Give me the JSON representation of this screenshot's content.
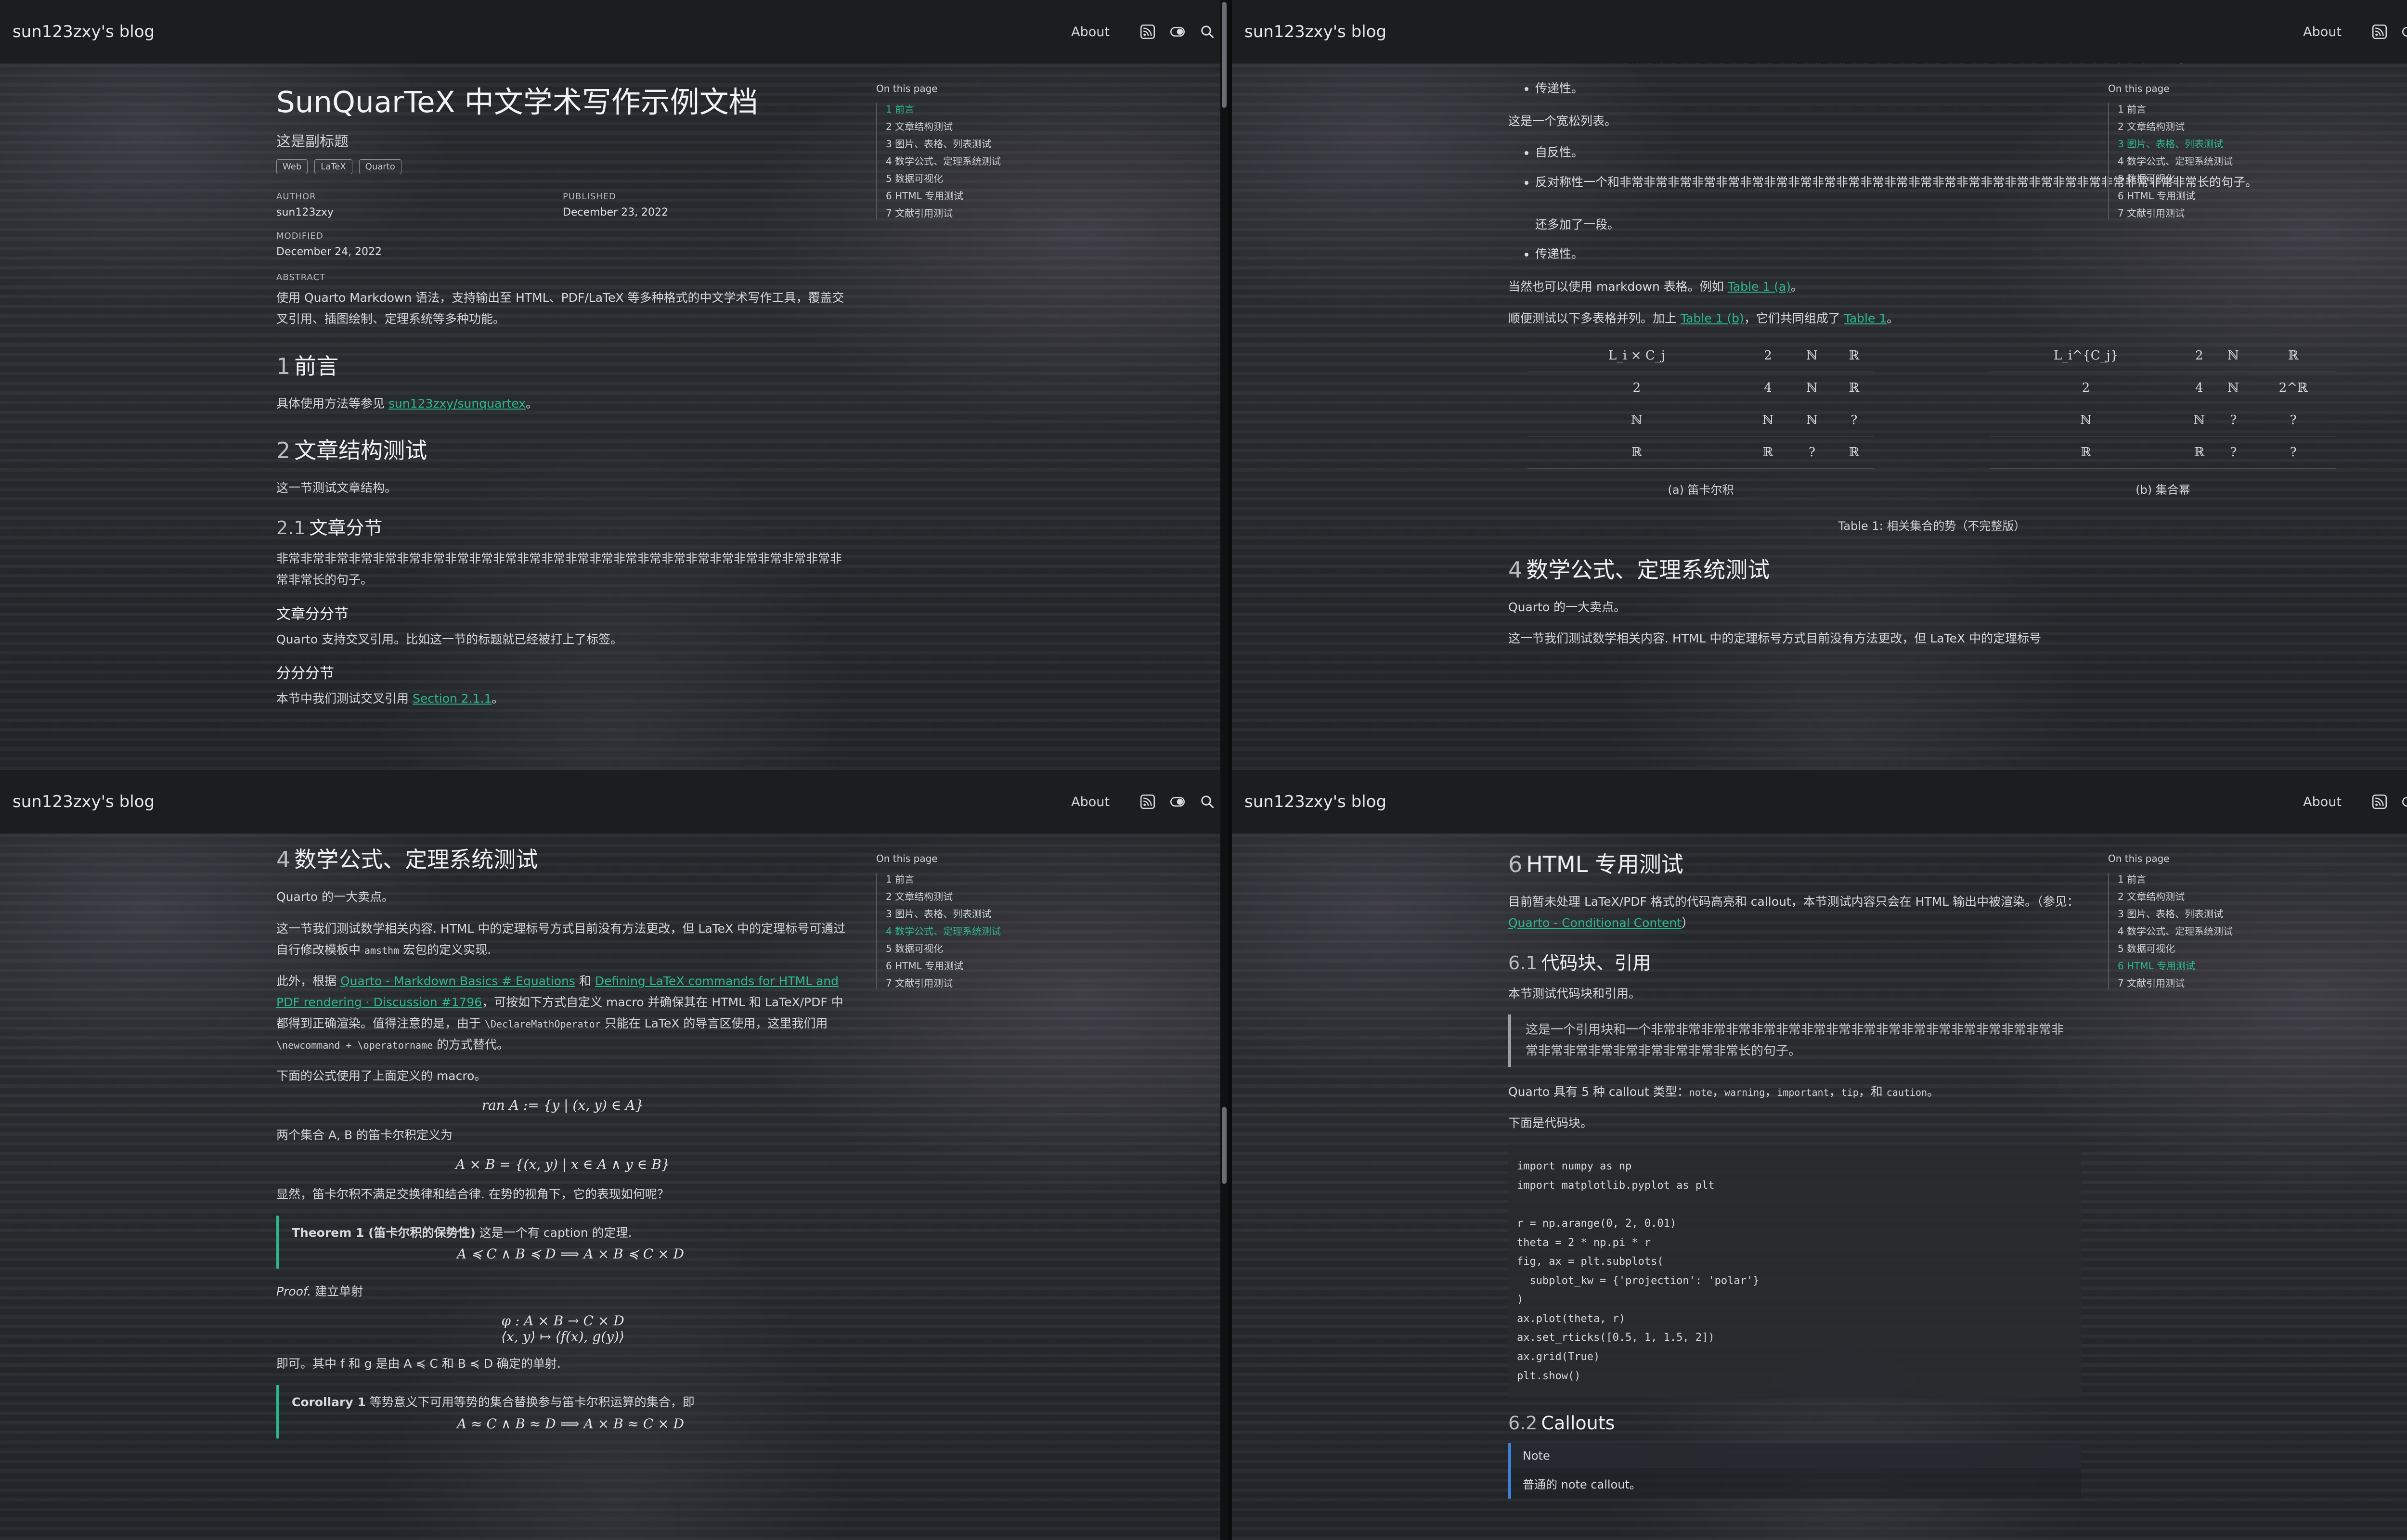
{
  "brand": "sun123zxy's blog",
  "nav": {
    "about": "About"
  },
  "toc": {
    "title": "On this page",
    "items": [
      "1 前言",
      "2 文章结构测试",
      "3 图片、表格、列表测试",
      "4 数学公式、定理系统测试",
      "5 数据可视化",
      "6 HTML 专用测试",
      "7 文献引用测试"
    ]
  },
  "p1": {
    "title": "SunQuarTeX 中文学术写作示例文档",
    "subtitle": "这是副标题",
    "cats": [
      "Web",
      "LaTeX",
      "Quarto"
    ],
    "meta": {
      "author_label": "Author",
      "author": "sun123zxy",
      "published_label": "Published",
      "published": "December 23, 2022",
      "modified_label": "Modified",
      "modified": "December 24, 2022"
    },
    "abstract_label": "Abstract",
    "abstract": "使用 Quarto Markdown 语法，支持输出至 HTML、PDF/LaTeX 等多种格式的中文学术写作工具，覆盖交叉引用、插图绘制、定理系统等多种功能。",
    "h_intro_num": "1",
    "h_intro": "前言",
    "intro_text": "具体使用方法等参见 ",
    "intro_link": "sun123zxy/sunquartex",
    "intro_end": "。",
    "h_struct_num": "2",
    "h_struct": "文章结构测试",
    "struct_text": "这一节测试文章结构。",
    "h_sub_num": "2.1",
    "h_sub": "文章分节",
    "sub_text": "非常非常非常非常非常非常非常非常非常非常非常非常非常非常非常非常非常非常非常非常非常非常非常非常非常长的句子。",
    "h_subsub": "文章分分节",
    "subsub_text": "Quarto 支持交叉引用。比如这一节的标题就已经被打上了标签。",
    "h_subsubsub": "分分分节",
    "subsubsub_text": "本节中我们测试交叉引用 ",
    "subsubsub_link": "Section 2.1.1",
    "subsubsub_end": "。"
  },
  "p2": {
    "li1": "反对称性一个和非常非常非常非常非常非常非常非常非常非常非常非常非常非常非常非常非常非常非常非常非常非常长的句子。",
    "li2": "传递性。",
    "wide_list": "这是一个宽松列表。",
    "li3": "自反性。",
    "li4": "反对称性一个和非常非常非常非常非常非常非常非常非常非常非常非常非常非常非常非常非常非常非常非常非常非常非常非常长的句子。",
    "li4b": "还多加了一段。",
    "li5": "传递性。",
    "md_table": "当然也可以使用 markdown 表格。例如 ",
    "md_link": "Table 1 (a)",
    "md_end": "。",
    "sub_tables": "顺便测试以下多表格并列。加上 ",
    "sub_link1": "Table 1 (b)",
    "sub_mid": "，它们共同组成了 ",
    "sub_link2": "Table 1",
    "sub_end": "。",
    "table_a": {
      "rows": [
        [
          "L_i × C_j",
          "2",
          "ℕ",
          "ℝ"
        ],
        [
          "2",
          "4",
          "ℕ",
          "ℝ"
        ],
        [
          "ℕ",
          "ℕ",
          "ℕ",
          "?"
        ],
        [
          "ℝ",
          "ℝ",
          "?",
          "ℝ"
        ]
      ],
      "caption": "(a) 笛卡尔积"
    },
    "table_b": {
      "rows": [
        [
          "L_i^{C_j}",
          "2",
          "ℕ",
          "ℝ"
        ],
        [
          "2",
          "4",
          "ℕ",
          "2^ℝ"
        ],
        [
          "ℕ",
          "ℕ",
          "?",
          "?"
        ],
        [
          "ℝ",
          "ℝ",
          "?",
          "?"
        ]
      ],
      "caption": "(b) 集合幂"
    },
    "table_caption": "Table 1: 相关集合的势（不完整版）",
    "h_math_num": "4",
    "h_math": "数学公式、定理系统测试",
    "math_text1": "Quarto 的一大卖点。",
    "math_text2": "这一节我们测试数学相关内容. HTML 中的定理标号方式目前没有方法更改，但 LaTeX 中的定理标号"
  },
  "p3": {
    "h_math_num": "4",
    "h_math": "数学公式、定理系统测试",
    "t1": "Quarto 的一大卖点。",
    "t2": "这一节我们测试数学相关内容. HTML 中的定理标号方式目前没有方法更改，但 LaTeX 中的定理标号可通过自行修改模板中 ",
    "t2_code": "amsthm",
    "t2_end": " 宏包的定义实现.",
    "t3a": "此外，根据 ",
    "t3_link1": "Quarto - Markdown Basics # Equations",
    "t3_and": " 和 ",
    "t3_link2": "Defining LaTeX commands for HTML and PDF rendering · Discussion #1796",
    "t3b": "，可按如下方式自定义 macro 并确保其在 HTML 和 LaTeX/PDF 中都得到正确渲染。值得注意的是，由于 ",
    "t3_code1": "\\DeclareMathOperator",
    "t3c": " 只能在 LaTeX 的导言区使用，这里我们用 ",
    "t3_code2": "\\newcommand + \\operatorname",
    "t3d": " 的方式替代。",
    "t4": "下面的公式使用了上面定义的 macro。",
    "eq1": "ran A := {y | (x, y) ∈ A}",
    "t5": "两个集合 A, B 的笛卡尔积定义为",
    "eq2": "A × B = {(x, y) | x ∈ A ∧ y ∈ B}",
    "t6": "显然，笛卡尔积不满足交换律和结合律. 在势的视角下，它的表现如何呢？",
    "thm_head": "Theorem 1 (笛卡尔积的保势性)",
    "thm_text": " 这是一个有 caption 的定理.",
    "eq3": "A ≼ C ∧ B ≼ D ⟹ A × B ≼ C × D",
    "proof_head": "Proof.",
    "proof_text": " 建立单射",
    "eq4a": "φ : A × B → C × D",
    "eq4b": "⟨x, y⟩ ↦ ⟨f(x), g(y)⟩",
    "t7": "即可。其中 f 和 g 是由 A ≼ C 和 B ≼ D 确定的单射.",
    "cor_head": "Corollary 1",
    "cor_text": " 等势意义下可用等势的集合替换参与笛卡尔积运算的集合，即",
    "eq5": "A ≈ C ∧ B ≈ D ⟹ A × B ≈ C × D"
  },
  "p4": {
    "h_html_num": "6",
    "h_html": "HTML 专用测试",
    "t1": "目前暂未处理 LaTeX/PDF 格式的代码高亮和 callout，本节测试内容只会在 HTML 输出中被渲染。（参见：",
    "t1_link": "Quarto - Conditional Content",
    "t1_end": "）",
    "h_code_num": "6.1",
    "h_code": "代码块、引用",
    "t2": "本节测试代码块和引用。",
    "quote": "这是一个引用块和一个非常非常非常非常非常非常非常非常非常非常非常非常非常非常非常非常非常非常非常非常非常非常非常非常非常长的句子。",
    "t3a": "Quarto 具有 5 种 callout 类型：",
    "c1": "note",
    "c2": "warning",
    "c3": "important",
    "c4": "tip",
    "t3_and": "和",
    "c5": "caution",
    "t3_end": "。",
    "t4": "下面是代码块。",
    "code": [
      "import numpy as np",
      "import matplotlib.pyplot as plt",
      "",
      "r = np.arange(0, 2, 0.01)",
      "theta = 2 * np.pi * r",
      "fig, ax = plt.subplots(",
      "  subplot_kw = {'projection': 'polar'}",
      ")",
      "ax.plot(theta, r)",
      "ax.set_rticks([0.5, 1, 1.5, 2])",
      "ax.grid(True)",
      "plt.show()"
    ],
    "h_callout_num": "6.2",
    "h_callout": "Callouts",
    "note_head": "Note",
    "note_body": "普通的 note callout。"
  }
}
